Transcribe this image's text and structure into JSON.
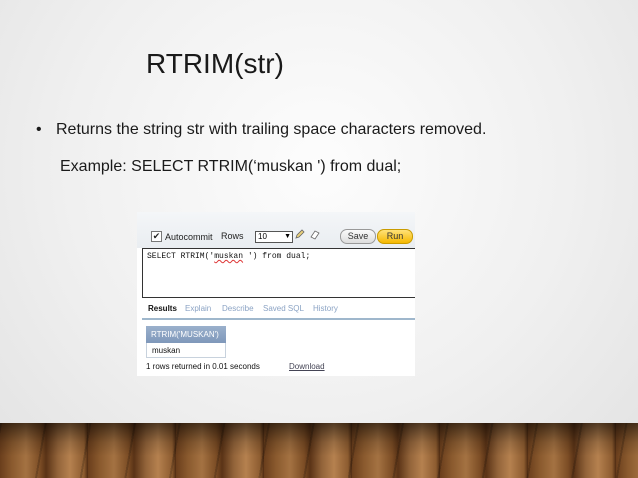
{
  "slide": {
    "title": "RTRIM(str)",
    "bullet_marker": "•",
    "bullet_text": "Returns the string str with trailing space characters removed.",
    "example_text": "Example: SELECT RTRIM(‘muskan ') from dual;"
  },
  "sql_tool": {
    "autocommit_checkbox": "✔",
    "autocommit_label": "Autocommit",
    "rows_label": "Rows",
    "rows_value": "10",
    "rows_arrow": "▼",
    "save_label": "Save",
    "run_label": "Run",
    "editor": {
      "before": "SELECT RTRIM('",
      "highlight": "muskan",
      "after": " ') from dual;"
    },
    "tabs": [
      "Results",
      "Explain",
      "Describe",
      "Saved SQL",
      "History"
    ],
    "result_column": "RTRIM('MUSKAN')",
    "result_value": "muskan",
    "status": "1 rows returned in 0.01 seconds",
    "download_label": "Download"
  }
}
